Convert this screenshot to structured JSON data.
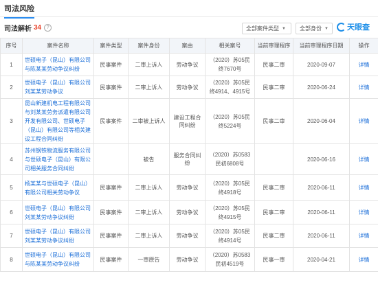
{
  "section": {
    "title": "司法风险"
  },
  "toolbar": {
    "sub_title": "司法解析",
    "count": "34",
    "help_icon": "?",
    "filter1": "全部案件类型",
    "filter2": "全部身份",
    "logo_text": "天眼查"
  },
  "table": {
    "headers": [
      "序号",
      "案件名称",
      "案件类型",
      "案件身份",
      "案由",
      "相关案号",
      "当前审理程序",
      "当前审理程序日期",
      "操作"
    ],
    "rows": [
      {
        "index": "1",
        "name": "世硕电子（昆山）有限公司与陈某某劳动争议纠纷",
        "type": "民事案件",
        "role": "二审上诉人",
        "cause": "劳动争议",
        "case_no": "（2020）苏05民终7670号",
        "stage": "民事二审",
        "date": "2020-09-07",
        "action": "详情"
      },
      {
        "index": "2",
        "name": "世硕电子（昆山）有限公司刘某某劳动争议",
        "type": "民事案件",
        "role": "二审上诉人",
        "cause": "劳动争议",
        "case_no": "（2020）苏05民终4914、4915号",
        "stage": "民事二审",
        "date": "2020-06-24",
        "action": "详情"
      },
      {
        "index": "3",
        "name": "昆山新建机电工程有限公司与刘某某劳务派遣有限公司开发有限公司、世硕电子（昆山）有限公司等相关建设工程合同纠纷",
        "type": "民事案件",
        "role": "二审被上诉人",
        "cause": "建设工程合同纠纷",
        "case_no": "（2020）苏05民终5224号",
        "stage": "民事二审",
        "date": "2020-06-04",
        "action": "详情"
      },
      {
        "index": "4",
        "name": "苏州钢铁物流服务有限公司与世硕电子（昆山）有限公司相关服务合同纠纷",
        "type": "",
        "role": "被告",
        "cause": "服务合同纠纷",
        "case_no": "（2020）苏0583民初6808号",
        "stage": "",
        "date": "2020-06-16",
        "action": "详情"
      },
      {
        "index": "5",
        "name": "杨某某与世硕电子（昆山）有限公司相关劳动争议",
        "type": "民事案件",
        "role": "二审上诉人",
        "cause": "劳动争议",
        "case_no": "（2020）苏05民终4918号",
        "stage": "民事二审",
        "date": "2020-06-11",
        "action": "详情"
      },
      {
        "index": "6",
        "name": "世硕电子（昆山）有限公司刘某某劳动争议纠纷",
        "type": "民事案件",
        "role": "二审上诉人",
        "cause": "劳动争议",
        "case_no": "（2020）苏05民终4915号",
        "stage": "民事二审",
        "date": "2020-06-11",
        "action": "详情"
      },
      {
        "index": "7",
        "name": "世硕电子（昆山）有限公司刘某某劳动争议纠纷",
        "type": "民事案件",
        "role": "二审上诉人",
        "cause": "劳动争议",
        "case_no": "（2020）苏05民终4914号",
        "stage": "民事二审",
        "date": "2020-06-11",
        "action": "详情"
      },
      {
        "index": "8",
        "name": "世硕电子（昆山）有限公司与陈某某劳动争议纠纷",
        "type": "民事案件",
        "role": "一审原告",
        "cause": "劳动争议",
        "case_no": "（2020）苏0583民初4519号",
        "stage": "民事一审",
        "date": "2020-04-21",
        "action": "详情"
      }
    ]
  },
  "colors": {
    "accent": "#1c8ee8",
    "link": "#1c6fd8",
    "count": "#e8462e",
    "header_bg": "#f2f5f9"
  }
}
